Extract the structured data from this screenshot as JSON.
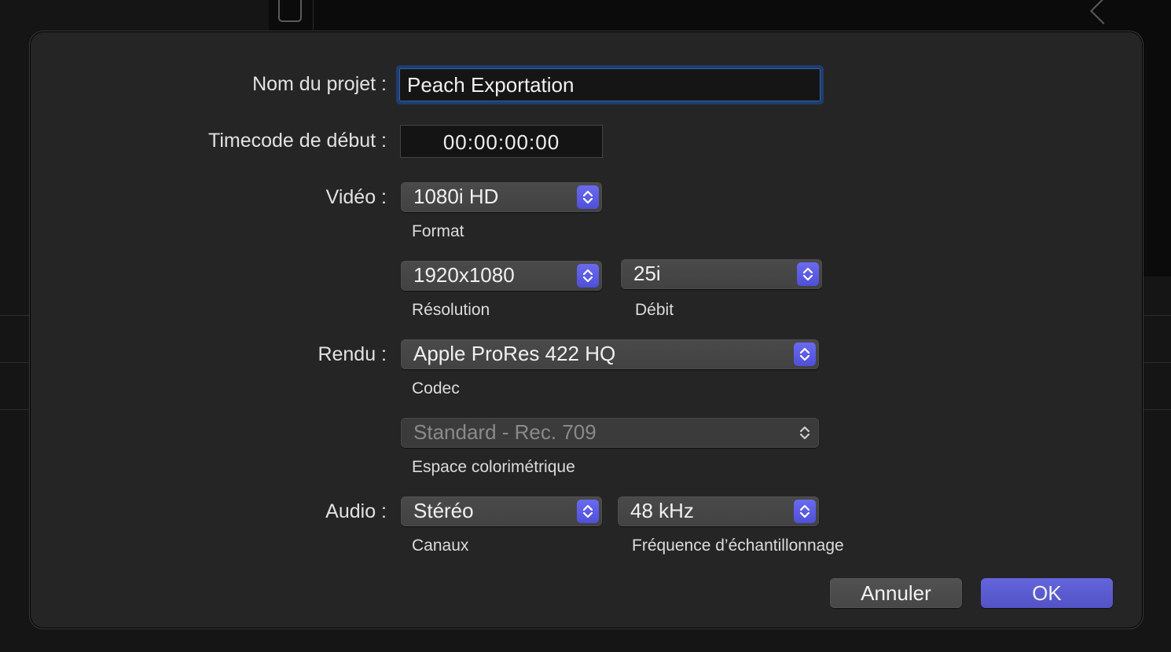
{
  "dialog": {
    "project_name_label": "Nom du projet :",
    "project_name_value": "Peach Exportation",
    "timecode_label": "Timecode de début :",
    "timecode_value": "00:00:00:00",
    "video": {
      "label": "Vidéo :",
      "format_value": "1080i HD",
      "format_caption": "Format",
      "resolution_value": "1920x1080",
      "resolution_caption": "Résolution",
      "rate_value": "25i",
      "rate_caption": "Débit"
    },
    "render": {
      "label": "Rendu :",
      "codec_value": "Apple ProRes 422 HQ",
      "codec_caption": "Codec",
      "colorspace_value": "Standard - Rec. 709",
      "colorspace_caption": "Espace colorimétrique"
    },
    "audio": {
      "label": "Audio :",
      "channels_value": "Stéréo",
      "channels_caption": "Canaux",
      "samplerate_value": "48 kHz",
      "samplerate_caption": "Fréquence d’échantillonnage"
    },
    "buttons": {
      "cancel": "Annuler",
      "ok": "OK"
    }
  },
  "colors": {
    "accent": "#5a5ad2",
    "focus_ring": "#1e3d70",
    "dialog_bg": "#252525"
  },
  "icons": {
    "popup_arrows": "chevron-up-down-icon"
  }
}
